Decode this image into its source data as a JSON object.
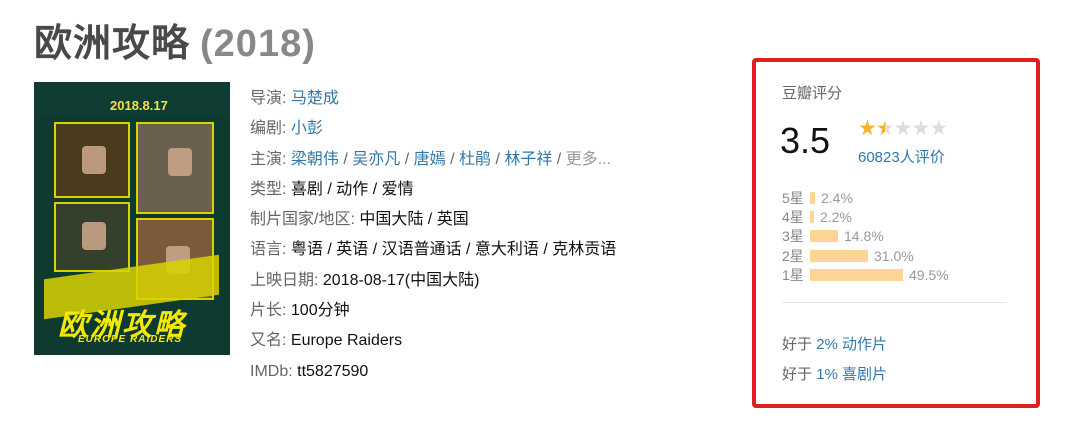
{
  "title": {
    "name": "欧洲攻略",
    "year": "(2018)"
  },
  "poster": {
    "date": "2018.8.17",
    "title": "欧洲攻略",
    "subtitle": "EUROPE RAIDERS"
  },
  "info": {
    "director_label": "导演:",
    "director": "马楚成",
    "writer_label": "编剧:",
    "writer": "小彭",
    "cast_label": "主演:",
    "cast": [
      "梁朝伟",
      "吴亦凡",
      "唐嫣",
      "杜鹃",
      "林子祥"
    ],
    "cast_sep": " / ",
    "cast_more": "更多...",
    "genre_label": "类型:",
    "genre": "喜剧 / 动作 / 爱情",
    "country_label": "制片国家/地区:",
    "country": "中国大陆 / 英国",
    "language_label": "语言:",
    "language": "粤语 / 英语 / 汉语普通话 / 意大利语 / 克林贡语",
    "release_label": "上映日期:",
    "release": "2018-08-17(中国大陆)",
    "runtime_label": "片长:",
    "runtime": "100分钟",
    "aka_label": "又名:",
    "aka": "Europe Raiders",
    "imdb_label": "IMDb:",
    "imdb": "tt5827590"
  },
  "rating": {
    "label": "豆瓣评分",
    "score": "3.5",
    "stars_filled": 1.5,
    "votes": "60823人评价",
    "accent_color": "#f5b427",
    "bar_color": "#ffd596",
    "distribution": [
      {
        "label": "5星",
        "pct_text": "2.4%",
        "pct": 2.4
      },
      {
        "label": "4星",
        "pct_text": "2.2%",
        "pct": 2.2
      },
      {
        "label": "3星",
        "pct_text": "14.8%",
        "pct": 14.8
      },
      {
        "label": "2星",
        "pct_text": "31.0%",
        "pct": 31.0
      },
      {
        "label": "1星",
        "pct_text": "49.5%",
        "pct": 49.5
      }
    ],
    "better_than": [
      {
        "prefix": "好于",
        "pct": "2%",
        "genre": "动作片"
      },
      {
        "prefix": "好于",
        "pct": "1%",
        "genre": "喜剧片"
      }
    ]
  }
}
